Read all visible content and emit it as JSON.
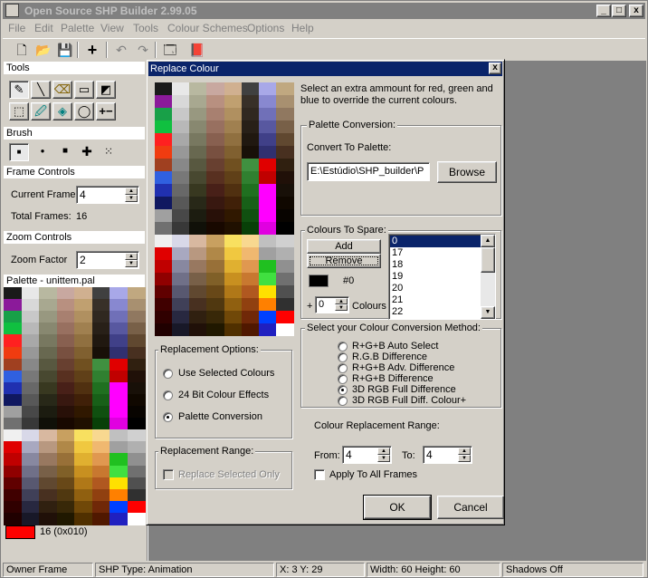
{
  "app": {
    "title": "Open Source SHP Builder 2.99.05",
    "window_buttons": [
      "_",
      "□",
      "x"
    ]
  },
  "menu": [
    "File",
    "Edit",
    "Palette",
    "View",
    "Tools",
    "Colour Schemes",
    "Options",
    "Help"
  ],
  "toolbar": {
    "icons": [
      "new-icon",
      "open-icon",
      "save-icon",
      "plus-icon",
      "undo-icon",
      "redo-icon",
      "preview-icon",
      "book-icon"
    ]
  },
  "left": {
    "tools_title": "Tools",
    "brush_title": "Brush",
    "frame_title": "Frame Controls",
    "current_frame_label": "Current Frame",
    "current_frame_value": "4",
    "total_frames_label": "Total Frames:",
    "total_frames_value": "16",
    "zoom_title": "Zoom Controls",
    "zoom_label": "Zoom Factor",
    "zoom_value": "2",
    "palette_title": "Palette - unittem.pal",
    "selected_colour_label": "16 (0x010)",
    "selected_colour": "#ff0000"
  },
  "dialog": {
    "title": "Replace Colour",
    "close": "x",
    "intro": "Select an extra ammount for red, green and blue to override the current colours.",
    "palette_conversion_group": "Palette Conversion:",
    "convert_to_label": "Convert To Palette:",
    "convert_path": "E:\\Estúdio\\SHP_builder\\P",
    "browse_label": "Browse",
    "spare_group": "Colours To Spare:",
    "add_label": "Add",
    "remove_label": "Remove",
    "spare_colour": "#000000",
    "spare_colour_label": "#0",
    "colours_prefix": "+",
    "colours_value": "0",
    "colours_label": "Colours",
    "spare_list": [
      "0",
      "17",
      "18",
      "19",
      "20",
      "21",
      "22"
    ],
    "method_group": "Select your Colour Conversion Method:",
    "methods": [
      "R+G+B Auto Select",
      "R.G.B Difference",
      "R+G+B Adv. Difference",
      "R+G+B Difference",
      "3D RGB Full Difference",
      "3D RGB Full Diff. Colour+"
    ],
    "selected_method": 4,
    "range_label": "Colour Replacement Range:",
    "from_label": "From:",
    "from_value": "4",
    "to_label": "To:",
    "to_value": "4",
    "apply_all_label": "Apply To All Frames",
    "replacement_options_group": "Replacement Options:",
    "options": [
      "Use Selected Colours",
      "24 Bit Colour Effects",
      "Palette Conversion"
    ],
    "selected_option": 2,
    "replacement_range_group": "Replacement Range:",
    "replace_selected_only": "Replace Selected Only",
    "ok_label": "OK",
    "cancel_label": "Cancel"
  },
  "status": [
    "Owner Frame",
    "SHP Type: Animation",
    "X: 3 Y: 29",
    "Width: 60 Height: 60",
    "Shadows Off"
  ],
  "palette_columns": [
    [
      "#1a1a1a",
      "#8b1a9a",
      "#18a048",
      "#10c040",
      "#ff2020",
      "#f03c10",
      "#a04020",
      "#3060e0",
      "#2030b0",
      "#101860",
      "#a0a0a0",
      "#707070",
      "#f0f0f0",
      "#e00000",
      "#c00000",
      "#900000",
      "#600000",
      "#400000",
      "#300000",
      "#200000"
    ],
    [
      "#e8e8e8",
      "#d8d8d8",
      "#c8c8c8",
      "#b8b8b8",
      "#a8a8a8",
      "#989898",
      "#888888",
      "#787878",
      "#686868",
      "#585858",
      "#484848",
      "#383838",
      "#d8d8e8",
      "#a8a8c0",
      "#8888a0",
      "#707088",
      "#585870",
      "#404058",
      "#282840",
      "#181828"
    ],
    [
      "#b8b8a0",
      "#a8a890",
      "#989880",
      "#888870",
      "#787860",
      "#686850",
      "#585840",
      "#484830",
      "#383820",
      "#282818",
      "#1c1c10",
      "#101008",
      "#d8b8a0",
      "#b89880",
      "#987860",
      "#786048",
      "#604830",
      "#483020",
      "#302010",
      "#201008"
    ],
    [
      "#c8a8a0",
      "#b89080",
      "#a88070",
      "#987060",
      "#886050",
      "#785040",
      "#684030",
      "#583020",
      "#482018",
      "#381810",
      "#281008",
      "#180800",
      "#c8a060",
      "#b08848",
      "#987038",
      "#806028",
      "#684818",
      "#503810",
      "#382808",
      "#201800"
    ],
    [
      "#d0b090",
      "#c0a070",
      "#b09060",
      "#a08050",
      "#907040",
      "#806030",
      "#705020",
      "#604018",
      "#503010",
      "#402008",
      "#301800",
      "#201000",
      "#f8e060",
      "#f0c840",
      "#e0b030",
      "#c89020",
      "#b07818",
      "#906010",
      "#704808",
      "#503000"
    ],
    [
      "#404040",
      "#383028",
      "#302820",
      "#282018",
      "#201810",
      "#181008",
      "#409040",
      "#308030",
      "#207020",
      "#186018",
      "#105010",
      "#084008",
      "#f8d890",
      "#f0b870",
      "#e09850",
      "#c87830",
      "#b05820",
      "#904010",
      "#702808",
      "#501800"
    ],
    [
      "#a8a8e8",
      "#8888d0",
      "#7070b8",
      "#5858a0",
      "#404088",
      "#303070",
      "#e00000",
      "#c00000",
      "#ff00ff",
      "#ff00ff",
      "#ff00ff",
      "#e000e0",
      "#c0c0c0",
      "#a0a0a0",
      "#20c020",
      "#40e040",
      "#ffe000",
      "#ff8000",
      "#0040ff",
      "#2020c0"
    ],
    [
      "#c0a880",
      "#a89070",
      "#907860",
      "#786048",
      "#604830",
      "#483020",
      "#302010",
      "#201008",
      "#181008",
      "#100800",
      "#080400",
      "#000000",
      "#d0d0d0",
      "#b0b0b0",
      "#909090",
      "#707070",
      "#505050",
      "#303030",
      "#ff0000",
      "#ffffff"
    ]
  ]
}
